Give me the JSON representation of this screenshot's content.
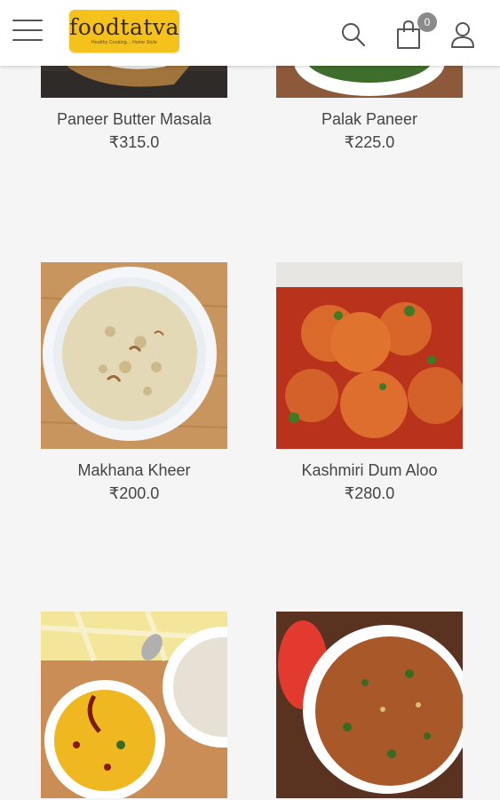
{
  "header": {
    "logo_text": "foodtatva",
    "logo_tagline": "Healthy Cooking... Home Style",
    "cart_count": "0"
  },
  "products": [
    {
      "name": "Paneer Butter Masala",
      "price": "₹315.0"
    },
    {
      "name": "Palak Paneer",
      "price": "₹225.0"
    },
    {
      "name": "Makhana Kheer",
      "price": "₹200.0"
    },
    {
      "name": "Kashmiri Dum Aloo",
      "price": "₹280.0"
    },
    {
      "name": "",
      "price": ""
    },
    {
      "name": "",
      "price": ""
    }
  ],
  "colors": {
    "brand_yellow": "#f5c21b",
    "background": "#f5f5f5",
    "badge": "#8a8a8a"
  }
}
